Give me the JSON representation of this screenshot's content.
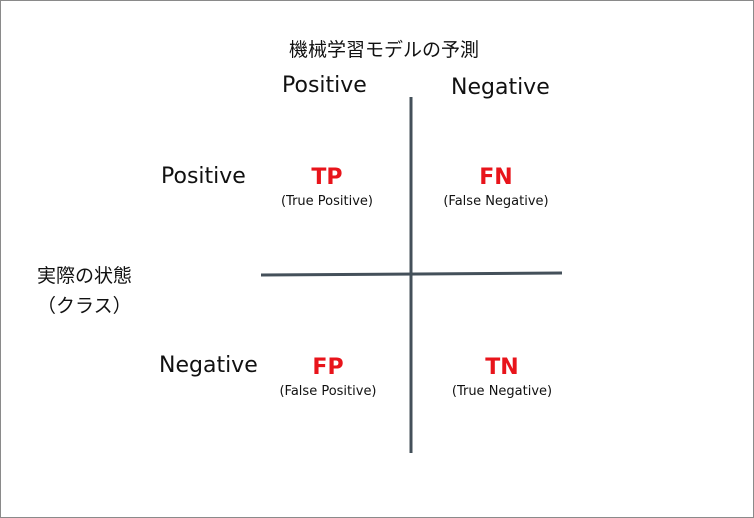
{
  "diagram": {
    "title": "機械学習モデルの予測",
    "predicted_positive": "Positive",
    "predicted_negative": "Negative",
    "actual_label_line1": "実際の状態",
    "actual_label_line2": "（クラス）",
    "actual_positive": "Positive",
    "actual_negative": "Negative",
    "cells": {
      "tp": {
        "abbr": "TP",
        "full": "(True Positive)"
      },
      "fn": {
        "abbr": "FN",
        "full": "(False Negative)"
      },
      "fp": {
        "abbr": "FP",
        "full": "(False Positive)"
      },
      "tn": {
        "abbr": "TN",
        "full": "(True Negative)"
      }
    },
    "colors": {
      "cell_abbr": "#e8141b",
      "axis_line": "#44505a",
      "border": "#8a8a8a"
    }
  }
}
